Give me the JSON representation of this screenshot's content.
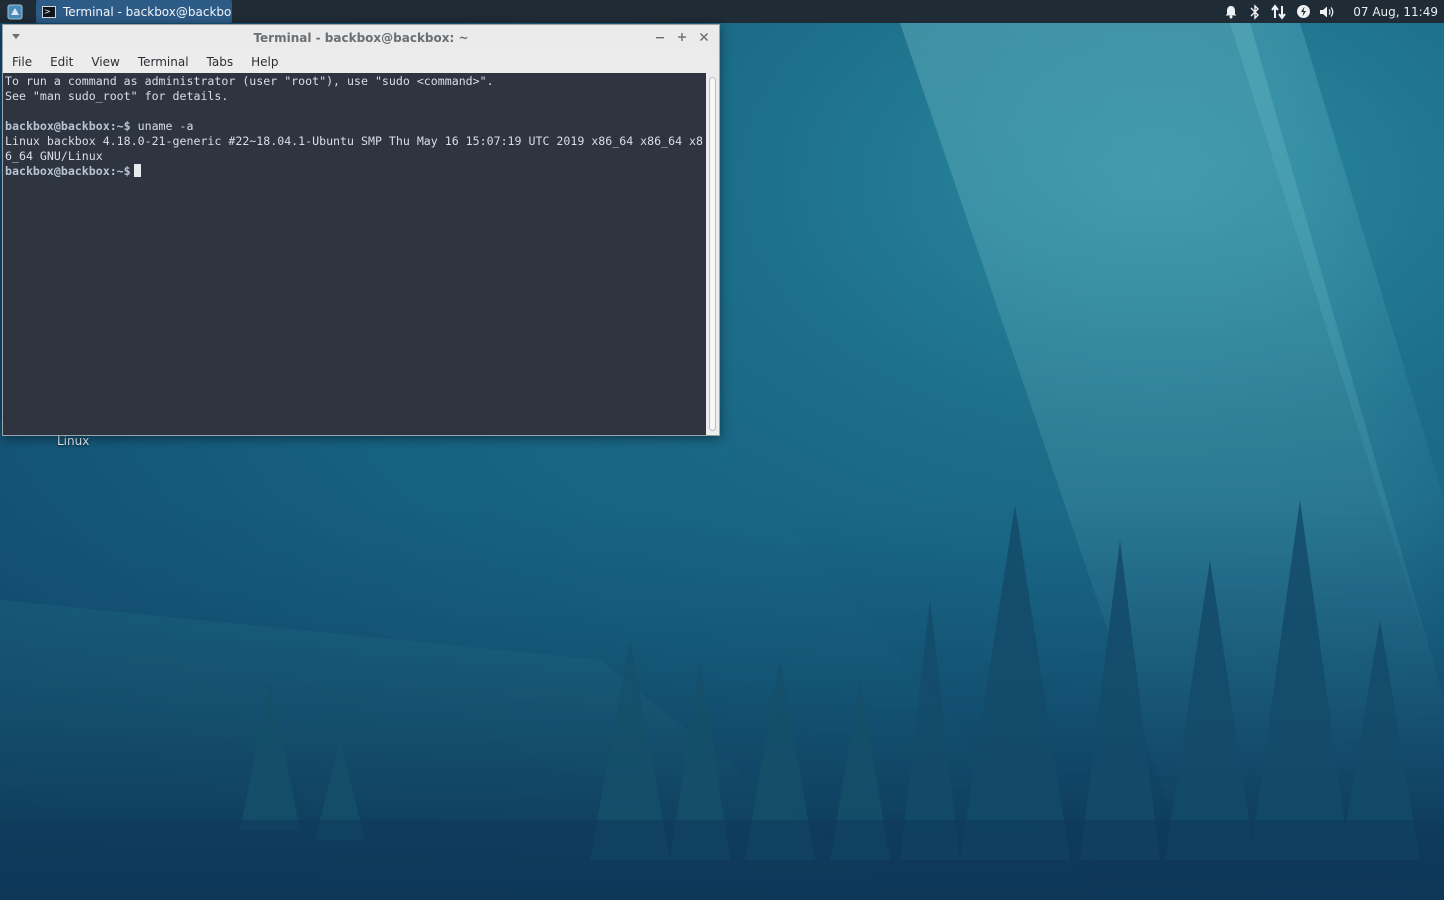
{
  "panel": {
    "task_title": "Terminal - backbox@backbo...",
    "clock": "07 Aug, 11:49",
    "tray_icons": [
      "bell-icon",
      "bluetooth-icon",
      "network-arrows-icon",
      "power-icon",
      "volume-icon"
    ]
  },
  "window": {
    "title": "Terminal - backbox@backbox: ~",
    "menu": [
      "File",
      "Edit",
      "View",
      "Terminal",
      "Tabs",
      "Help"
    ]
  },
  "terminal": {
    "line1": "To run a command as administrator (user \"root\"), use \"sudo <command>\".",
    "line2": "See \"man sudo_root\" for details.",
    "prompt": "backbox@backbox:~$",
    "command": " uname -a",
    "output1": "Linux backbox 4.18.0-21-generic #22~18.04.1-Ubuntu SMP Thu May 16 15:07:19 UTC 2019 x86_64 x86_64 x8",
    "output2": "6_64 GNU/Linux",
    "prompt2": "backbox@backbox:~$"
  },
  "desktop": {
    "icon_label": "Linux"
  },
  "colors": {
    "terminal_bg": "#2e3440",
    "panel_bg": "#1f2b35",
    "task_active": "#2d5b87"
  }
}
